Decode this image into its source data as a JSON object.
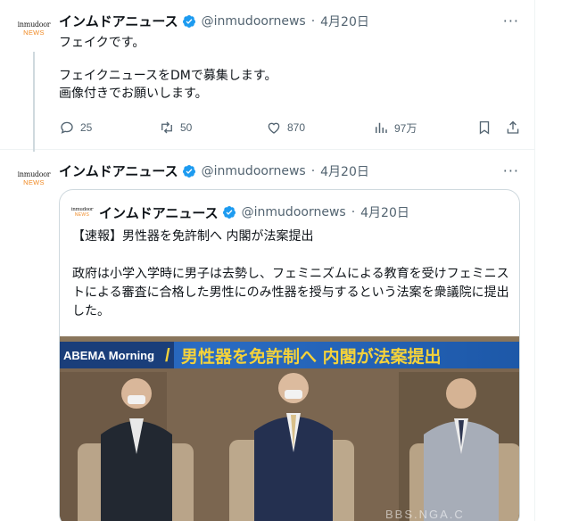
{
  "tweets": [
    {
      "avatar": {
        "top": "inmudoor",
        "bottom": "NEWS"
      },
      "author": "インムドアニュース",
      "handle": "@inmudoornews",
      "sep": "·",
      "date": "4月20日",
      "text": [
        "フェイクです。",
        "フェイクニュースをDMで募集します。",
        "画像付きでお願いします。"
      ],
      "actions": {
        "replies": "25",
        "retweets": "50",
        "likes": "870",
        "views": "97万"
      }
    },
    {
      "avatar": {
        "top": "inmudoor",
        "bottom": "NEWS"
      },
      "author": "インムドアニュース",
      "handle": "@inmudoornews",
      "sep": "·",
      "date": "4月20日",
      "quote": {
        "avatar": {
          "top": "inmudoor",
          "bottom": "NEWS"
        },
        "author": "インムドアニュース",
        "handle": "@inmudoornews",
        "sep": "·",
        "date": "4月20日",
        "headline": "【速報】男性器を免許制へ 内閣が法案提出",
        "body": "政府は小学入学時に男子は去勢し、フェミニズムによる教育を受けフェミニストによる審査に合格した男性にのみ性器を授与するという法案を衆議院に提出した。",
        "image": {
          "banner_logo": "ABEMA Morning",
          "banner_slash": "/",
          "banner_title": "男性器を免許制へ 内閣が法案提出",
          "watermark": "BBS.NGA.C"
        }
      }
    }
  ],
  "colors": {
    "accent": "#1d9bf0",
    "muted": "#536471",
    "border": "#cfd9de",
    "banner_blue": "#1f5fb0",
    "banner_yellow": "#f5d23a"
  }
}
